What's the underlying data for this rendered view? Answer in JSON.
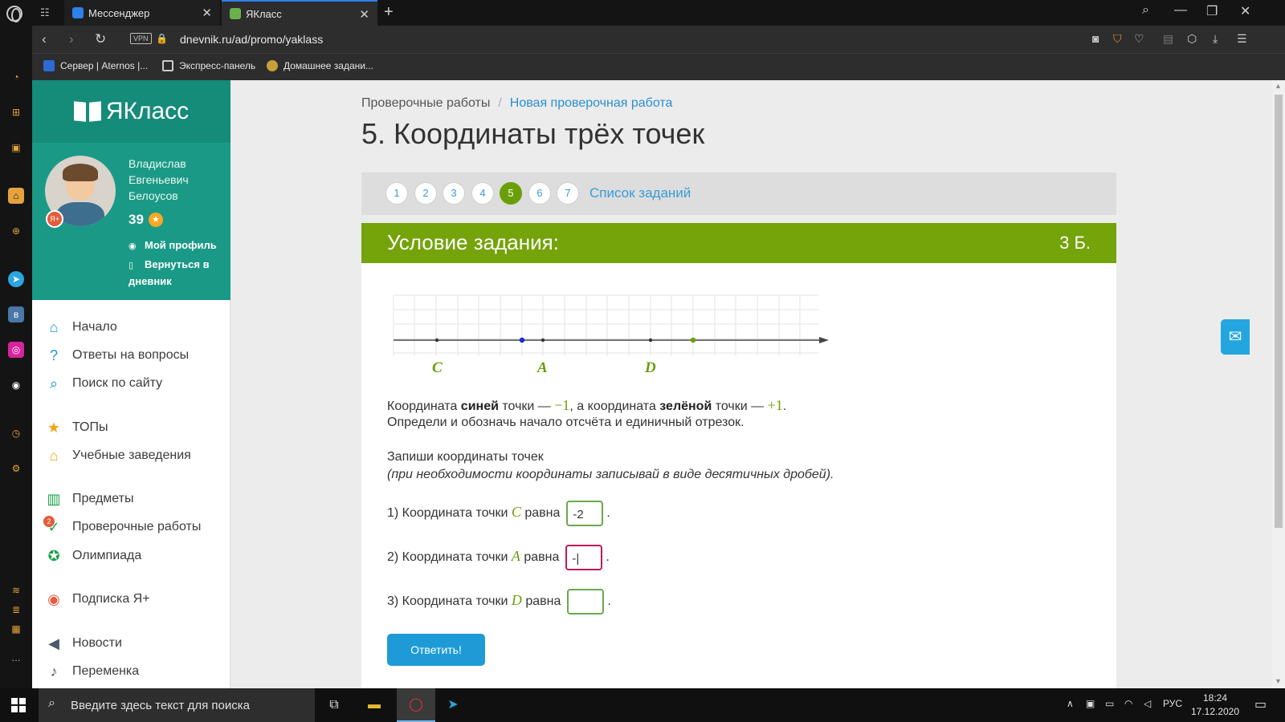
{
  "browser": {
    "tabs": [
      {
        "label": "Мессенджер",
        "active": false
      },
      {
        "label": "ЯКласс",
        "active": true
      }
    ],
    "url": "dnevnik.ru/ad/promo/yaklass",
    "vpn_label": "VPN",
    "bookmarks": [
      "Сервер | Aternos |...",
      "Экспресс-панель",
      "Домашнее задани..."
    ]
  },
  "site": {
    "logo_text": "ЯКласс",
    "user": {
      "first_name": "Владислав",
      "middle_name": "Евгеньевич",
      "last_name": "Белоусов",
      "points": "39",
      "badge": "Я+",
      "links": [
        "Мой профиль",
        "Вернуться в дневник"
      ]
    },
    "menu": [
      {
        "label": "Начало",
        "icon": "home-icon"
      },
      {
        "label": "Ответы на вопросы",
        "icon": "question-icon"
      },
      {
        "label": "Поиск по сайту",
        "icon": "search-icon"
      },
      {
        "label": "ТОПы",
        "icon": "star-icon"
      },
      {
        "label": "Учебные заведения",
        "icon": "school-icon"
      },
      {
        "label": "Предметы",
        "icon": "books-icon"
      },
      {
        "label": "Проверочные работы",
        "icon": "check-icon",
        "badge": "2"
      },
      {
        "label": "Олимпиада",
        "icon": "medal-icon"
      },
      {
        "label": "Подписка Я+",
        "icon": "subscription-icon"
      },
      {
        "label": "Новости",
        "icon": "megaphone-icon"
      },
      {
        "label": "Переменка",
        "icon": "bell-icon"
      }
    ]
  },
  "breadcrumb": {
    "parent": "Проверочные работы",
    "current": "Новая проверочная работа"
  },
  "page_title": "5. Координаты трёх точек",
  "pager": {
    "pages": [
      "1",
      "2",
      "3",
      "4",
      "5",
      "6",
      "7"
    ],
    "active": "5",
    "list_label": "Список заданий"
  },
  "task": {
    "header": "Условие задания:",
    "points": "3 Б.",
    "number_line": {
      "point_labels": [
        "C",
        "A",
        "D"
      ]
    },
    "text1_a": "Координата ",
    "text1_b": "синей",
    "text1_c": " точки — ",
    "text1_val1": "−1",
    "text1_d": ", а координата ",
    "text1_e": "зелёной",
    "text1_f": " точки — ",
    "text1_val2": "+1",
    "text1_g": ".",
    "text2": "Определи и обозначь начало отсчёта и единичный отрезок.",
    "text3": "Запиши координаты точек",
    "text4": "(при необходимости координаты записывай в виде десятичных дробей).",
    "questions": [
      {
        "prefix": "1) Координата точки ",
        "point": "C",
        "suffix": " равна",
        "value": "-2"
      },
      {
        "prefix": "2) Координата точки ",
        "point": "A",
        "suffix": " равна",
        "value": "-|"
      },
      {
        "prefix": "3) Координата точки ",
        "point": "D",
        "suffix": " равна",
        "value": ""
      }
    ],
    "submit_label": "Ответить!"
  },
  "taskbar": {
    "search_placeholder": "Введите здесь текст для поиска",
    "lang": "РУС",
    "time": "18:24",
    "date": "17.12.2020"
  }
}
